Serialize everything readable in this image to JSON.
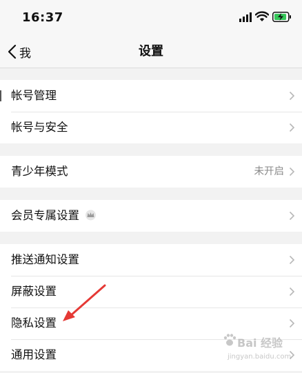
{
  "status": {
    "time": "16:37"
  },
  "nav": {
    "back_label": "我",
    "title": "设置"
  },
  "groups": [
    {
      "items": [
        {
          "label": "帐号管理"
        },
        {
          "label": "帐号与安全"
        }
      ]
    },
    {
      "items": [
        {
          "label": "青少年模式",
          "value": "未开启"
        }
      ]
    },
    {
      "items": [
        {
          "label": "会员专属设置",
          "icon": "crown-icon"
        }
      ]
    },
    {
      "items": [
        {
          "label": "推送通知设置"
        },
        {
          "label": "屏蔽设置"
        },
        {
          "label": "隐私设置"
        },
        {
          "label": "通用设置"
        }
      ]
    }
  ],
  "annotation": {
    "color": "#e53935",
    "target": "隐私设置"
  },
  "watermark": {
    "text": "Bai 经验",
    "url": "jingyan.baidu.com"
  },
  "colors": {
    "background": "#f2f2f2",
    "battery": "#35c759"
  }
}
